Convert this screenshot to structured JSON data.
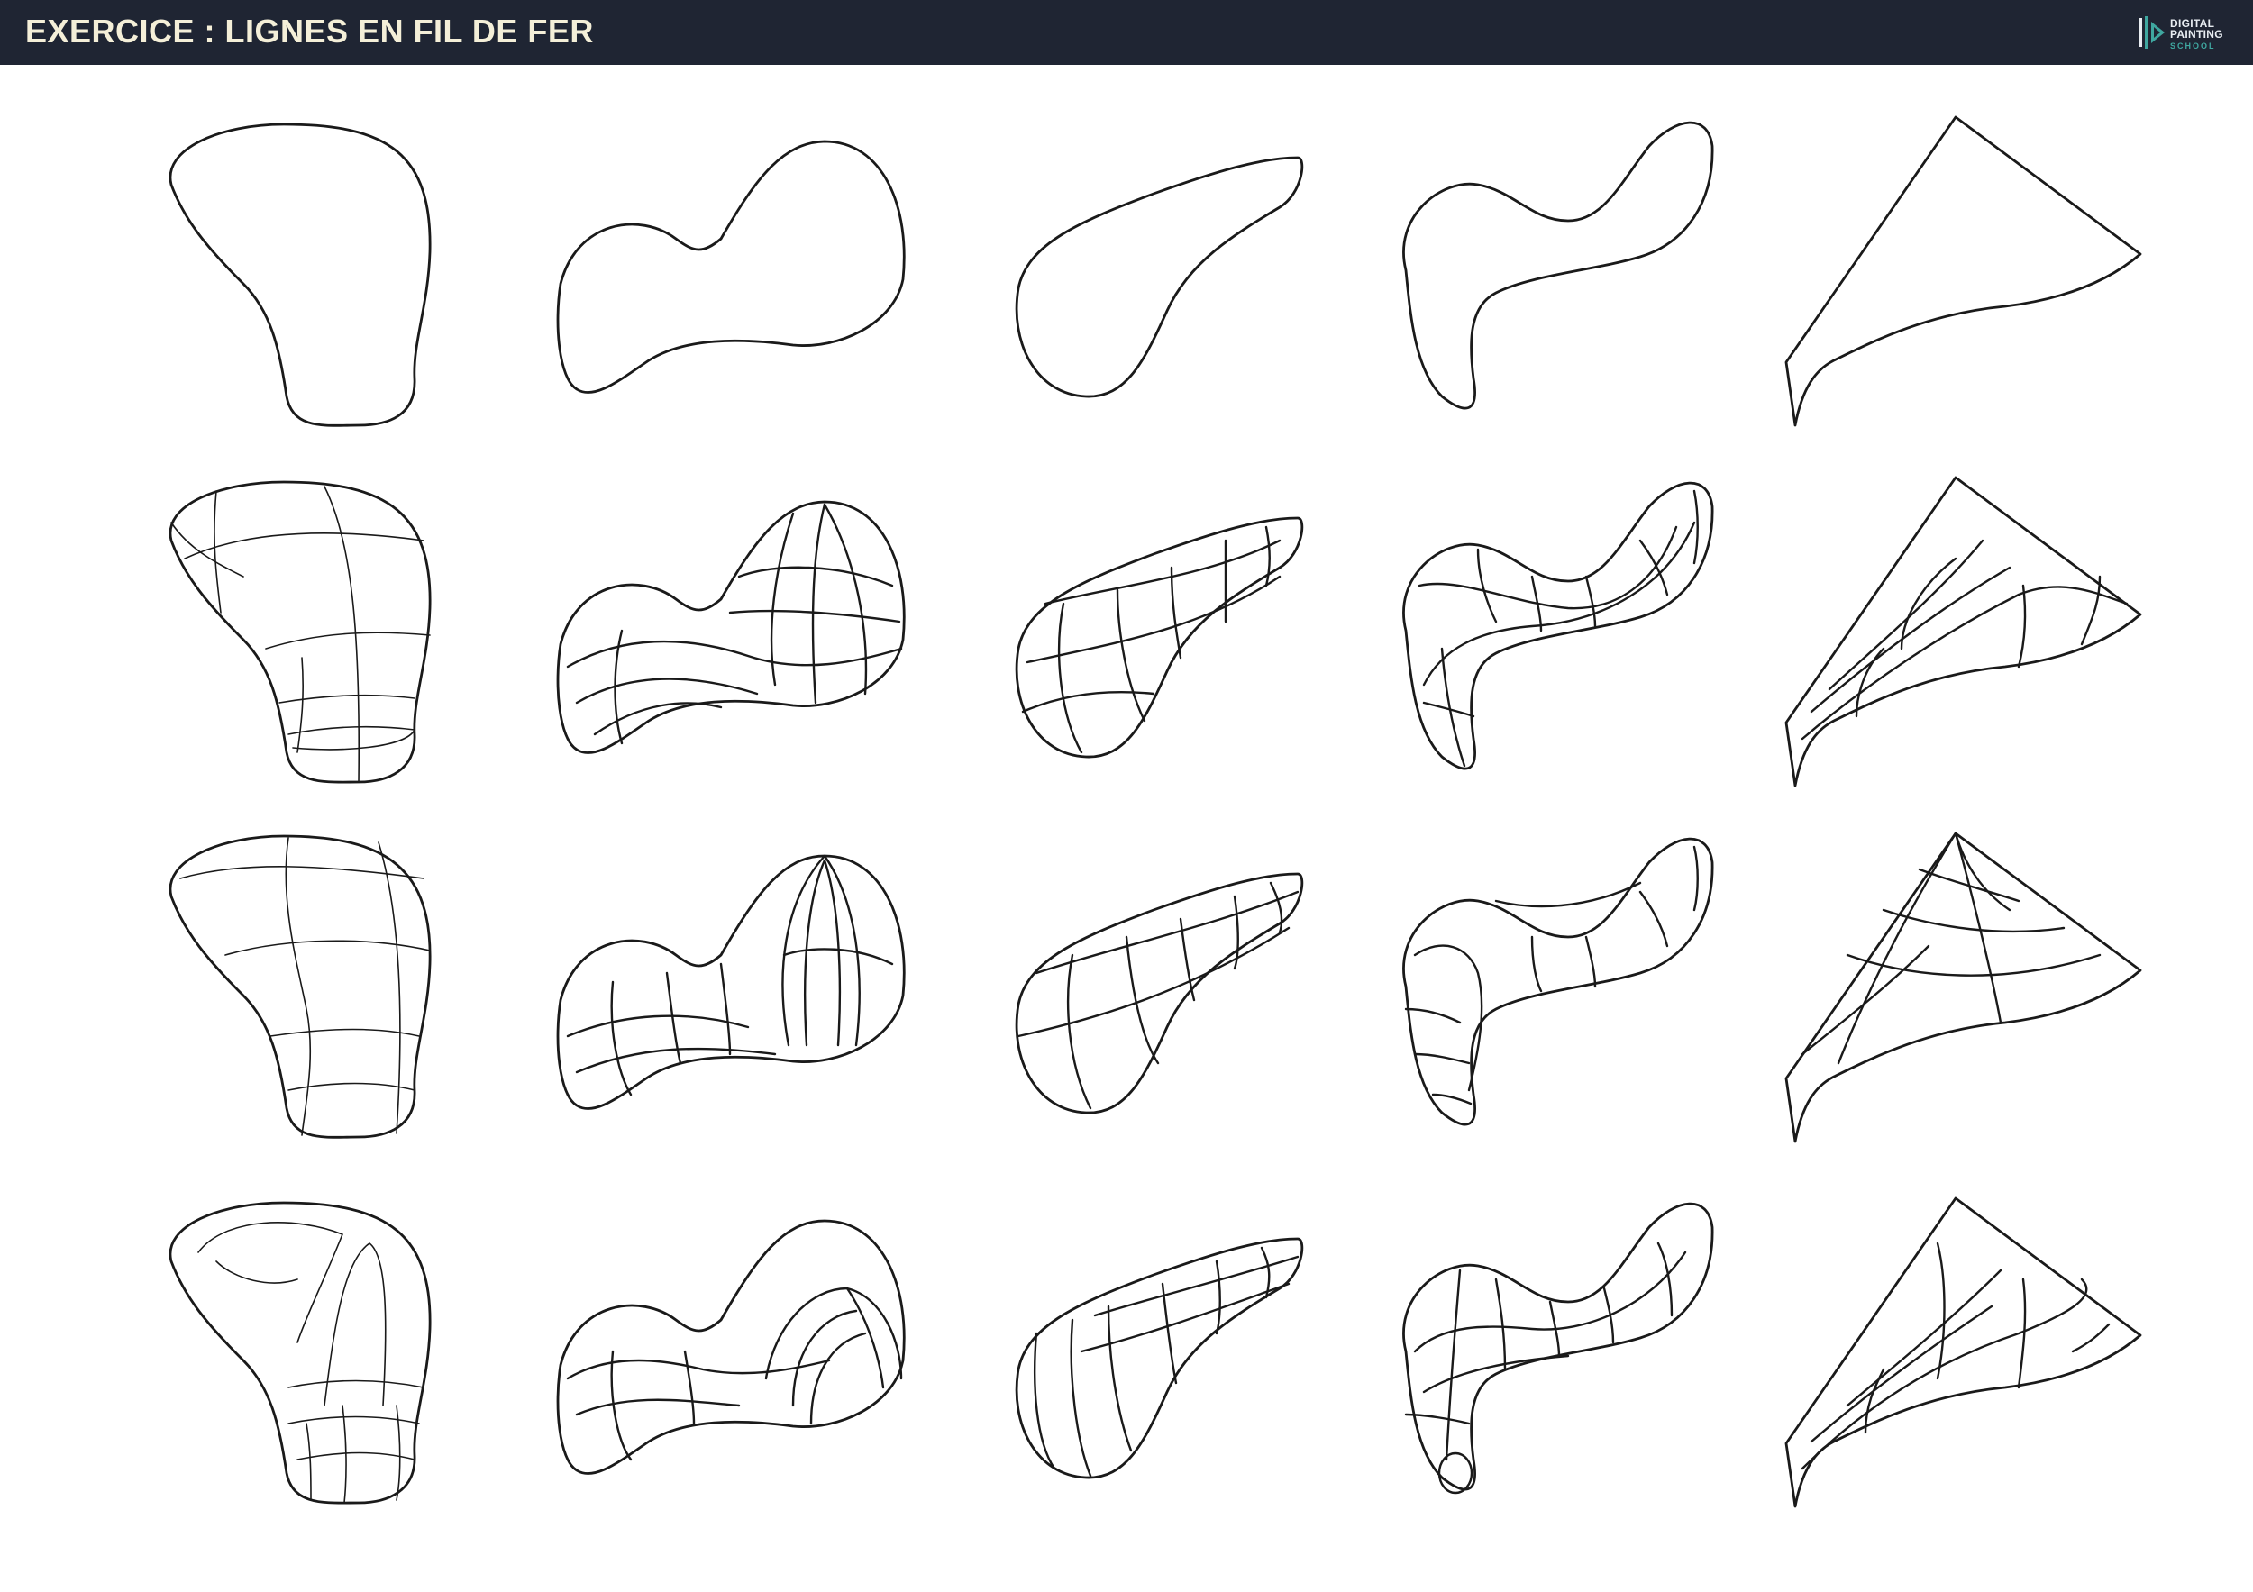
{
  "header": {
    "title": "EXERCICE : LIGNES EN FIL DE FER",
    "background": "#1f2533",
    "title_color": "#f4efd8"
  },
  "logo": {
    "line1": "DIGITAL",
    "line2": "PAINTING",
    "line3": "SCHOOL",
    "icon": "digital-painting-school-logo-icon",
    "accent": "#3fa7a0"
  },
  "exercise": {
    "columns": 5,
    "rows": 4
  }
}
